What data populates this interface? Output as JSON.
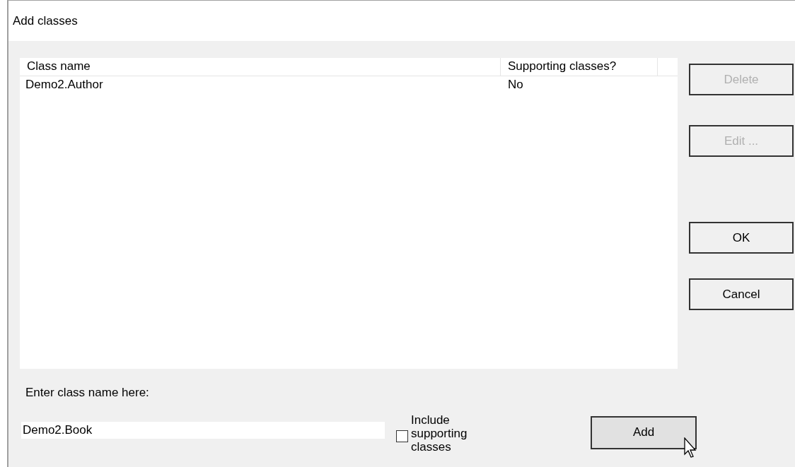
{
  "window": {
    "title": "Add classes"
  },
  "table": {
    "columns": [
      "Class name",
      "Supporting classes?"
    ],
    "rows": [
      {
        "cells": [
          "Demo2.Author",
          "No"
        ],
        "selected": false
      }
    ]
  },
  "side_buttons": [
    {
      "label": "Delete",
      "disabled": true
    },
    {
      "label": "Edit ...",
      "disabled": true
    },
    {
      "label": "OK",
      "disabled": false
    },
    {
      "label": "Cancel",
      "disabled": false
    }
  ],
  "class_name_label": "Enter class name here:",
  "class_name_field": {
    "value": "Demo2.Book"
  },
  "include_supporting": {
    "label": "Include supporting classes",
    "checked": false
  },
  "add_button": {
    "label": "Add",
    "hovered": true
  }
}
